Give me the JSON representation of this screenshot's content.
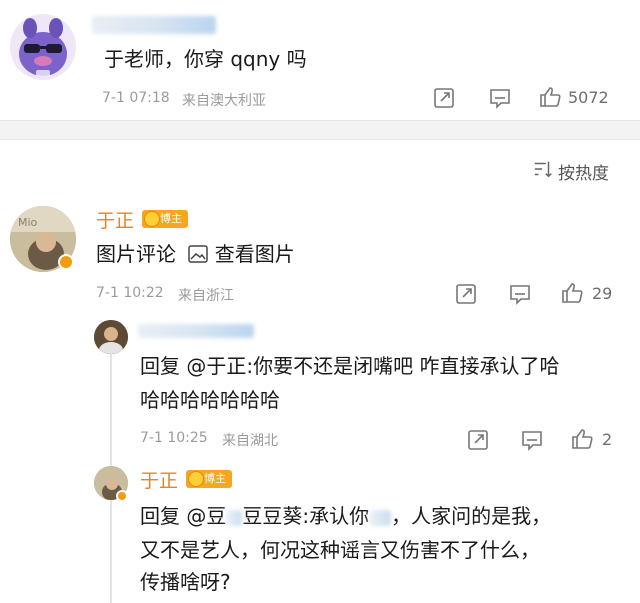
{
  "first_comment": {
    "text": "于老师，你穿 qqny 吗",
    "time": "7-1 07:18",
    "location": "来自澳大利亚",
    "likes": "5072"
  },
  "sort": {
    "label": "按热度"
  },
  "comment_main": {
    "username": "于正",
    "badge": "博主",
    "text": "图片评论",
    "view_image": "查看图片",
    "time": "7-1 10:22",
    "location": "来自浙江",
    "likes": "29"
  },
  "reply_1": {
    "prefix": "回复 ",
    "mention": "@于正",
    "line1": ":你要不还是闭嘴吧 咋直接承认了哈",
    "line2": "哈哈哈哈哈哈哈",
    "time": "7-1 10:25",
    "location": "来自湖北",
    "likes": "2"
  },
  "reply_2": {
    "username": "于正",
    "badge": "博主",
    "prefix": "回复 ",
    "mention_start": "@豆",
    "mention_end": "豆豆葵",
    "part1": ":承认你",
    "part2": "，人家问的是我，",
    "line2": "又不是艺人，何况这种谣言又伤害不了什么，",
    "line3": "传播啥呀?"
  },
  "colors": {
    "username": "#e8822a",
    "badge": "#f6a623",
    "meta": "#9b9b9b",
    "separator": "#f3f3f3"
  },
  "icons": [
    "share-icon",
    "comment-icon",
    "like-icon",
    "sort-icon",
    "image-icon"
  ]
}
